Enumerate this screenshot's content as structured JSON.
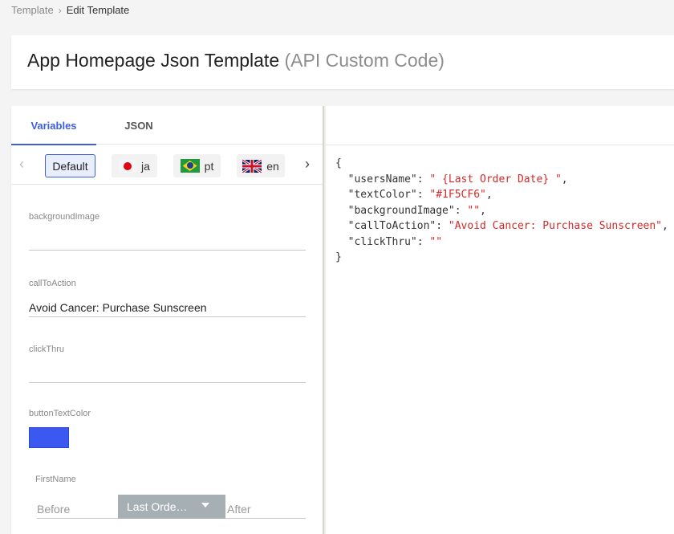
{
  "breadcrumb": {
    "parent": "Template",
    "separator": "›",
    "current": "Edit Template"
  },
  "header": {
    "title": "App Homepage Json Template",
    "subtitle": "(API Custom Code)"
  },
  "tabs": [
    {
      "label": "Variables",
      "active": true
    },
    {
      "label": "JSON",
      "active": false
    }
  ],
  "languages": [
    {
      "label": "Default",
      "selected": true
    },
    {
      "label": "ja",
      "flag": "japan-flag-icon"
    },
    {
      "label": "pt",
      "flag": "brazil-flag-icon"
    },
    {
      "label": "en",
      "flag": "uk-flag-icon"
    }
  ],
  "fields": {
    "backgroundImage": {
      "label": "backgroundImage",
      "value": ""
    },
    "callToAction": {
      "label": "callToAction",
      "value": "Avoid Cancer: Purchase Sunscreen"
    },
    "clickThru": {
      "label": "clickThru",
      "value": ""
    },
    "buttonTextColor": {
      "label": "buttonTextColor",
      "color": "#3B58F0"
    },
    "firstName": {
      "label": "FirstName",
      "before": "Before",
      "selected": "Last Orde…",
      "after": "After"
    }
  },
  "json_preview": {
    "open": "{",
    "close": "}",
    "lines": [
      {
        "key": "\"usersName\"",
        "value": "\" {Last Order Date} \"",
        "trail": ","
      },
      {
        "key": "\"textColor\"",
        "value": "\"#1F5CF6\"",
        "trail": ","
      },
      {
        "key": "\"backgroundImage\"",
        "value": "\"\"",
        "trail": ","
      },
      {
        "key": "\"callToAction\"",
        "value": "\"Avoid Cancer: Purchase Sunscreen\"",
        "trail": ","
      },
      {
        "key": "\"clickThru\"",
        "value": "\"\"",
        "trail": ""
      }
    ]
  },
  "colors": {
    "accent": "#3D5EE0",
    "json_string": "#D22A2A",
    "dropdown_bg": "#A6AFB3"
  }
}
